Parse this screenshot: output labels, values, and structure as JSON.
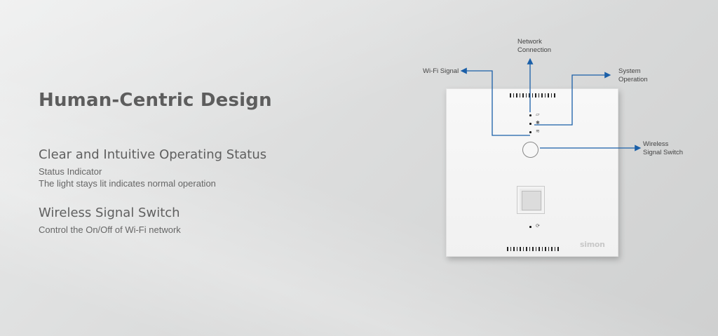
{
  "heading": "Human-Centric Design",
  "features": [
    {
      "title": "Clear and Intuitive Operating Status",
      "lines": [
        "Status Indicator",
        "The light stays lit indicates normal operation"
      ]
    },
    {
      "title": "Wireless Signal Switch",
      "lines": [
        "Control the On/Off of Wi-Fi network"
      ]
    }
  ],
  "device": {
    "brand": "simon",
    "icons": {
      "network_indicator": "network-icon",
      "system_indicator": "sun-icon",
      "wifi_indicator": "wifi-icon",
      "reset_indicator": "refresh-icon"
    }
  },
  "callouts": {
    "network": [
      "Network",
      "Connection"
    ],
    "wifi": [
      "Wi-Fi Signal"
    ],
    "system": [
      "System",
      "Operation"
    ],
    "switch": [
      "Wireless",
      "Signal Switch"
    ]
  },
  "colors": {
    "arrow": "#1a5fa8",
    "heading": "#5d5d5d"
  }
}
